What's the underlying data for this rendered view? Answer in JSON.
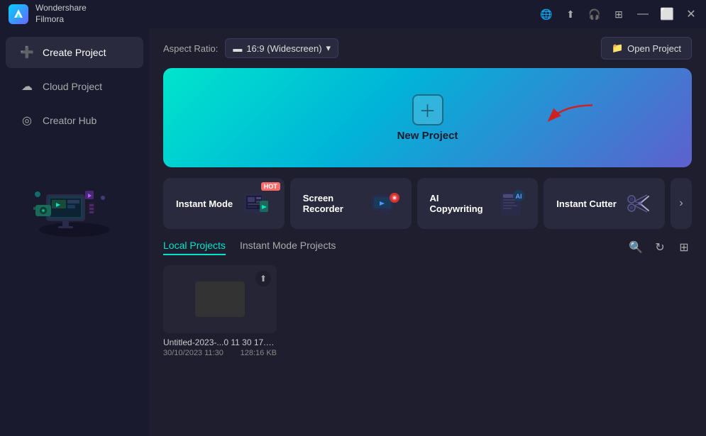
{
  "titlebar": {
    "app_name": "Wondershare\nFilmora",
    "app_name_line1": "Wondershare",
    "app_name_line2": "Filmora",
    "minimize": "—",
    "maximize": "⬜",
    "close": "✕"
  },
  "sidebar": {
    "items": [
      {
        "id": "create-project",
        "label": "Create Project",
        "icon": "➕",
        "active": true
      },
      {
        "id": "cloud-project",
        "label": "Cloud Project",
        "icon": "☁",
        "active": false
      },
      {
        "id": "creator-hub",
        "label": "Creator Hub",
        "icon": "◎",
        "active": false
      }
    ]
  },
  "topbar": {
    "aspect_ratio_label": "Aspect Ratio:",
    "aspect_ratio_value": "16:9 (Widescreen)",
    "open_project_label": "Open Project"
  },
  "banner": {
    "new_project_label": "New Project"
  },
  "tools": [
    {
      "id": "instant-mode",
      "label": "Instant Mode",
      "hot": true
    },
    {
      "id": "screen-recorder",
      "label": "Screen Recorder",
      "hot": false
    },
    {
      "id": "ai-copywriting",
      "label": "AI Copywriting",
      "hot": false
    },
    {
      "id": "instant-cutter",
      "label": "Instant Cutter",
      "hot": false
    }
  ],
  "projects": {
    "tabs": [
      {
        "id": "local",
        "label": "Local Projects",
        "active": true
      },
      {
        "id": "instant-mode",
        "label": "Instant Mode Projects",
        "active": false
      }
    ],
    "items": [
      {
        "name": "Untitled-2023-...0 11 30 17.wfp",
        "date": "30/10/2023 11:30",
        "size": "128:16 KB"
      }
    ]
  }
}
